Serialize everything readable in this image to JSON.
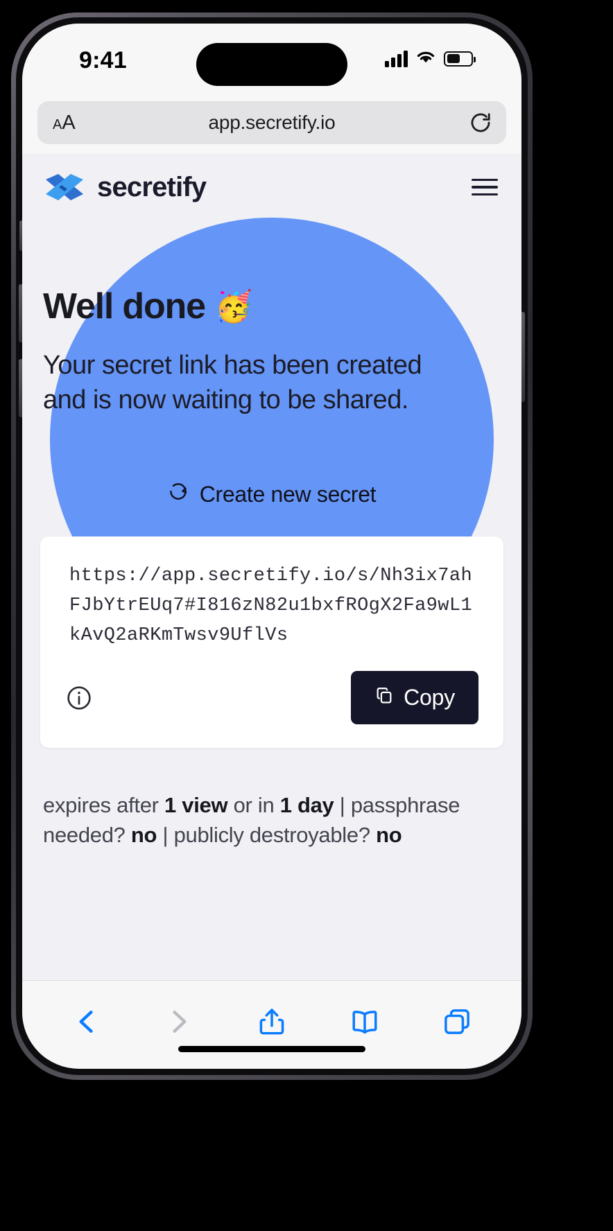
{
  "status_bar": {
    "time": "9:41",
    "signal_icon": "cellular-bars-icon",
    "wifi_icon": "wifi-icon",
    "battery_icon": "battery-icon"
  },
  "browser": {
    "text_size_label_small": "A",
    "text_size_label_large": "A",
    "url": "app.secretify.io",
    "reload_icon": "reload-icon",
    "toolbar": {
      "back_icon": "chevron-left-icon",
      "forward_icon": "chevron-right-icon",
      "share_icon": "share-icon",
      "bookmarks_icon": "book-icon",
      "tabs_icon": "tabs-icon"
    }
  },
  "page": {
    "brand_name": "secretify",
    "brand_logo_icon": "secretify-logo-icon",
    "menu_icon": "hamburger-menu-icon",
    "heading": "Well done",
    "heading_emoji": "🥳",
    "subtitle": "Your secret link has been created and is now waiting to be shared.",
    "create_new_label": "Create new secret",
    "create_new_icon": "rotate-ccw-icon",
    "secret_url": "https://app.secretify.io/s/Nh3ix7ahFJbYtrEUq7#I816zN82u1bxfROgX2Fa9wL1kAvQ2aRKmTwsv9UflVs",
    "info_icon": "info-circle-icon",
    "copy_label": "Copy",
    "copy_icon": "copy-icon",
    "meta": {
      "expires_prefix": "expires after ",
      "views": "1 view",
      "or_in": " or in ",
      "duration": "1 day",
      "sep1": " | passphrase needed? ",
      "passphrase_needed": "no",
      "sep2": " | publicly destroyable? ",
      "publicly_destroyable": "no"
    }
  },
  "colors": {
    "accent_blue": "#6495f7",
    "page_bg": "#f0f0f5",
    "card_bg": "#ffffff",
    "button_dark": "#16162a",
    "safari_blue": "#0a7cff"
  }
}
